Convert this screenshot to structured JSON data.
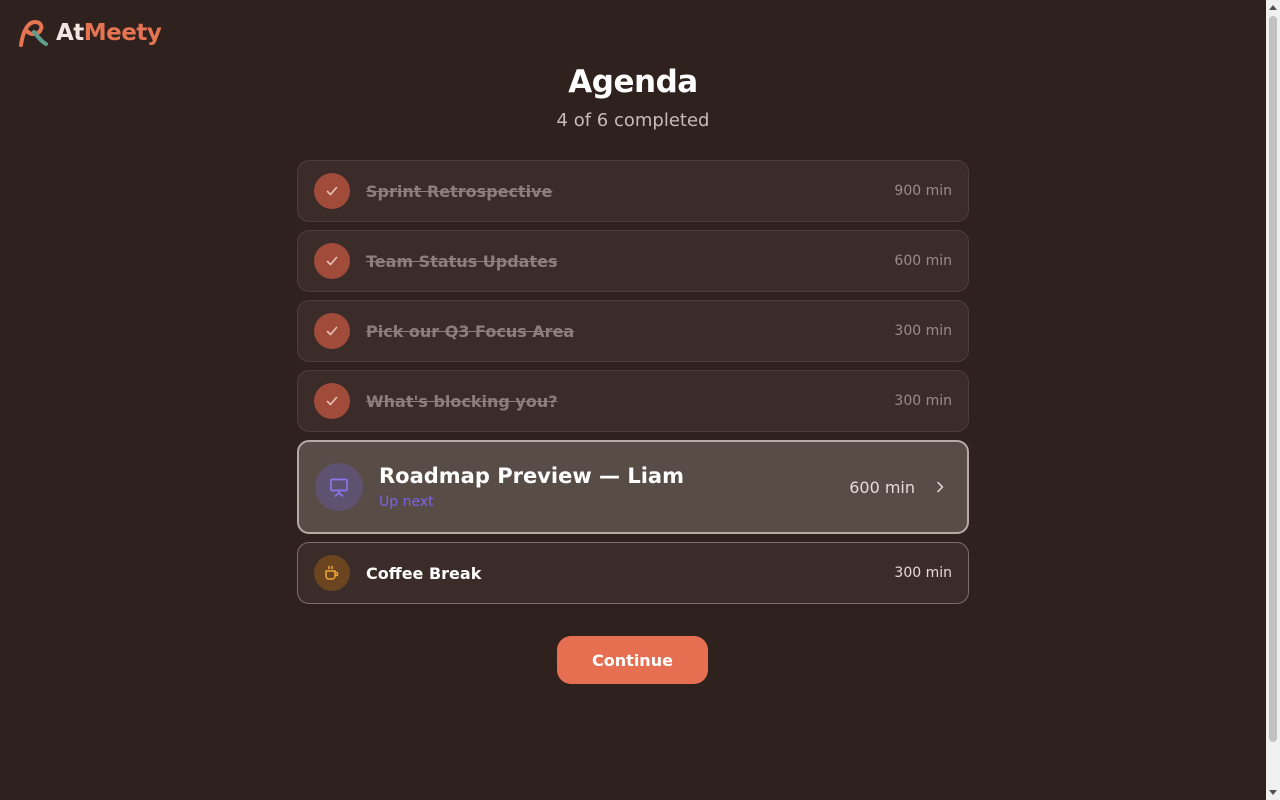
{
  "brand": {
    "prefix": "At",
    "suffix": "Meety",
    "accent": "#e47452"
  },
  "header": {
    "title": "Agenda",
    "progress_text": "4 of 6 completed"
  },
  "progress": {
    "completed": 4,
    "total": 6
  },
  "agenda": {
    "completed_items": [
      {
        "title": "Sprint Retrospective",
        "duration": "900 min"
      },
      {
        "title": "Team Status Updates",
        "duration": "600 min"
      },
      {
        "title": "Pick our Q3 Focus Area",
        "duration": "300 min"
      },
      {
        "title": "What's blocking you?",
        "duration": "300 min"
      }
    ],
    "current_item": {
      "title": "Roadmap Preview — Liam",
      "status": "Up next",
      "duration": "600 min",
      "icon": "presentation-icon"
    },
    "pending_item": {
      "title": "Coffee Break",
      "duration": "300 min",
      "icon": "coffee-icon"
    }
  },
  "actions": {
    "continue_label": "Continue"
  },
  "colors": {
    "background": "#2f211e",
    "primary_button": "#e76f51",
    "check": "#a14b3b",
    "up_next": "#7c63e6"
  }
}
